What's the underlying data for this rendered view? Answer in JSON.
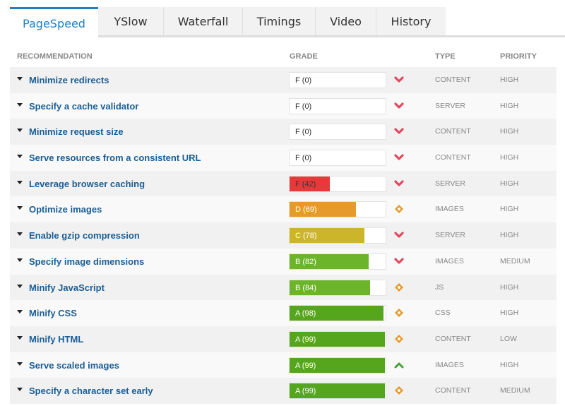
{
  "tabs": [
    {
      "label": "PageSpeed",
      "active": true
    },
    {
      "label": "YSlow",
      "active": false
    },
    {
      "label": "Waterfall",
      "active": false
    },
    {
      "label": "Timings",
      "active": false
    },
    {
      "label": "Video",
      "active": false
    },
    {
      "label": "History",
      "active": false
    }
  ],
  "columns": {
    "recommendation": "RECOMMENDATION",
    "grade": "GRADE",
    "type": "TYPE",
    "priority": "PRIORITY"
  },
  "colors": {
    "F": "#e8393a",
    "D": "#e69a2a",
    "C": "#cdb52a",
    "B": "#6cb52a",
    "A": "#56a61d",
    "trend_down": "#e04a5f",
    "trend_neutral": "#e69a2a",
    "trend_up": "#4aa03a",
    "link": "#1a5e96",
    "accent": "#1f7fc0"
  },
  "rows": [
    {
      "recommendation": "Minimize redirects",
      "grade": "F (0)",
      "letter": "F",
      "score": 0,
      "trend": "down",
      "type": "CONTENT",
      "priority": "HIGH"
    },
    {
      "recommendation": "Specify a cache validator",
      "grade": "F (0)",
      "letter": "F",
      "score": 0,
      "trend": "down",
      "type": "SERVER",
      "priority": "HIGH"
    },
    {
      "recommendation": "Minimize request size",
      "grade": "F (0)",
      "letter": "F",
      "score": 0,
      "trend": "down",
      "type": "CONTENT",
      "priority": "HIGH"
    },
    {
      "recommendation": "Serve resources from a consistent URL",
      "grade": "F (0)",
      "letter": "F",
      "score": 0,
      "trend": "down",
      "type": "CONTENT",
      "priority": "HIGH"
    },
    {
      "recommendation": "Leverage browser caching",
      "grade": "F (42)",
      "letter": "F",
      "score": 42,
      "trend": "down",
      "type": "SERVER",
      "priority": "HIGH"
    },
    {
      "recommendation": "Optimize images",
      "grade": "D (69)",
      "letter": "D",
      "score": 69,
      "trend": "neutral",
      "type": "IMAGES",
      "priority": "HIGH"
    },
    {
      "recommendation": "Enable gzip compression",
      "grade": "C (78)",
      "letter": "C",
      "score": 78,
      "trend": "down",
      "type": "SERVER",
      "priority": "HIGH"
    },
    {
      "recommendation": "Specify image dimensions",
      "grade": "B (82)",
      "letter": "B",
      "score": 82,
      "trend": "down",
      "type": "IMAGES",
      "priority": "MEDIUM"
    },
    {
      "recommendation": "Minify JavaScript",
      "grade": "B (84)",
      "letter": "B",
      "score": 84,
      "trend": "neutral",
      "type": "JS",
      "priority": "HIGH"
    },
    {
      "recommendation": "Minify CSS",
      "grade": "A (98)",
      "letter": "A",
      "score": 98,
      "trend": "neutral",
      "type": "CSS",
      "priority": "HIGH"
    },
    {
      "recommendation": "Minify HTML",
      "grade": "A (99)",
      "letter": "A",
      "score": 99,
      "trend": "neutral",
      "type": "CONTENT",
      "priority": "LOW"
    },
    {
      "recommendation": "Serve scaled images",
      "grade": "A (99)",
      "letter": "A",
      "score": 99,
      "trend": "up",
      "type": "IMAGES",
      "priority": "HIGH"
    },
    {
      "recommendation": "Specify a character set early",
      "grade": "A (99)",
      "letter": "A",
      "score": 99,
      "trend": "neutral",
      "type": "CONTENT",
      "priority": "MEDIUM"
    }
  ]
}
